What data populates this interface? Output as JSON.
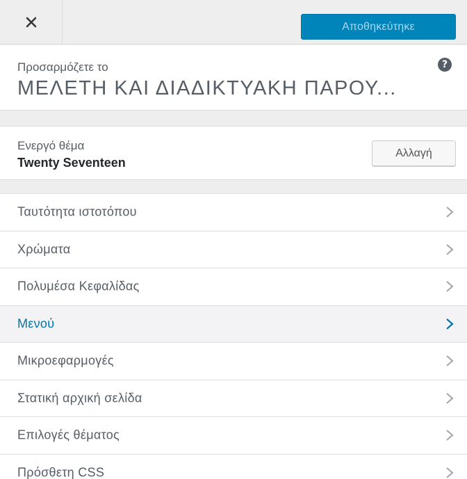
{
  "header": {
    "close_icon": "close-icon",
    "saved_label": "Αποθηκεύτηκε",
    "accent_color": "#0085ba"
  },
  "info": {
    "label": "Προσαρμόζετε το",
    "site_title": "ΜΕΛΕΤΗ ΚΑΙ ΔΙΑΔΙΚΤΥΑΚΗ ΠΑΡΟΥ...",
    "help_icon": "help-icon",
    "help_glyph": "?"
  },
  "theme": {
    "label": "Ενεργό θέμα",
    "name": "Twenty Seventeen",
    "change_label": "Αλλαγή"
  },
  "sections": {
    "active_color": "#0073aa",
    "items": [
      {
        "label": "Ταυτότητα ιστοτόπου",
        "active": false
      },
      {
        "label": "Χρώματα",
        "active": false
      },
      {
        "label": "Πολυμέσα Κεφαλίδας",
        "active": false
      },
      {
        "label": "Μενού",
        "active": true
      },
      {
        "label": "Μικροεφαρμογές",
        "active": false
      },
      {
        "label": "Στατική αρχική σελίδα",
        "active": false
      },
      {
        "label": "Επιλογές θέματος",
        "active": false
      },
      {
        "label": "Πρόσθετη CSS",
        "active": false
      }
    ]
  }
}
